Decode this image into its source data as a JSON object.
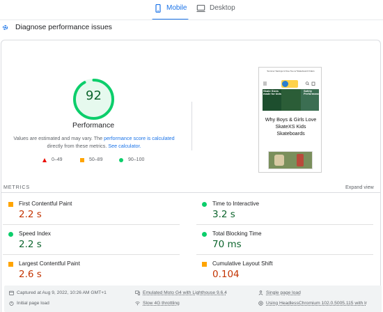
{
  "tabs": [
    {
      "label": "Mobile",
      "icon": "mobile-phone-icon",
      "active": true
    },
    {
      "label": "Desktop",
      "icon": "desktop-monitor-icon",
      "active": false
    }
  ],
  "diagnose": {
    "title": "Diagnose performance issues"
  },
  "performance": {
    "score": "92",
    "title": "Performance",
    "estimate_prefix": "Values are estimated and may vary. The ",
    "estimate_link1": "performance score is calculated",
    "estimate_middle": " directly from these metrics. ",
    "estimate_link2": "See calculator."
  },
  "legend": [
    {
      "range": "0–49",
      "shape": "triangle",
      "color": "#eb0f00"
    },
    {
      "range": "50–89",
      "shape": "square",
      "color": "#ffa400"
    },
    {
      "range": "90–100",
      "shape": "circle",
      "color": "#0cce6b"
    }
  ],
  "preview": {
    "top_text": "Summer Savings & Free Tee w/ Skateboard Orders",
    "banner_left": "Skate Sizes made for kids",
    "banner_right": "Safety Performance",
    "caption": "Why Boys & Girls Love SkateXS Kids Skateboards"
  },
  "metrics": {
    "header": "METRICS",
    "expand": "Expand view",
    "items": [
      {
        "name": "First Contentful Paint",
        "value": "2.2 s",
        "status": "average"
      },
      {
        "name": "Time to Interactive",
        "value": "3.2 s",
        "status": "pass"
      },
      {
        "name": "Speed Index",
        "value": "2.2 s",
        "status": "pass"
      },
      {
        "name": "Total Blocking Time",
        "value": "70 ms",
        "status": "pass"
      },
      {
        "name": "Largest Contentful Paint",
        "value": "2.6 s",
        "status": "average"
      },
      {
        "name": "Cumulative Layout Shift",
        "value": "0.104",
        "status": "average"
      }
    ]
  },
  "footer": {
    "captured": "Captured at Aug 9, 2022, 10:26 AM GMT+1",
    "initial": "Initial page load",
    "device": "Emulated Moto G4 with Lighthouse 9.6.4",
    "throttling": "Slow 4G throttling",
    "session": "Single page load",
    "browser": "Using HeadlessChromium 102.0.5005.115 with lr"
  },
  "colors": {
    "accent": "#1a73e8",
    "pass": "#0cce6b",
    "pass_text": "#0d652d",
    "average": "#ffa400",
    "average_text": "#c33300",
    "fail": "#eb0f00"
  }
}
